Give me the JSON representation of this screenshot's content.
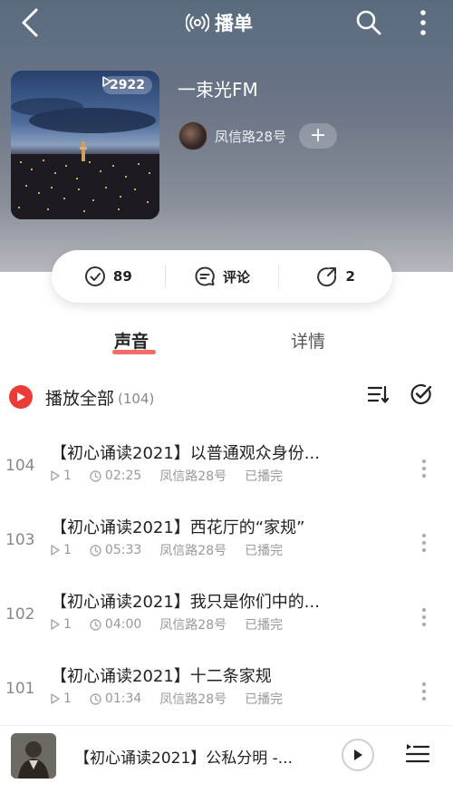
{
  "nav": {
    "title": "播单"
  },
  "playlist": {
    "title": "一束光FM",
    "play_count": "2922",
    "creator_name": "凤信路28号",
    "follow_label": "+"
  },
  "actions": {
    "subscribe_count": "89",
    "comment_label": "评论",
    "share_count": "2"
  },
  "tabs": [
    {
      "label": "声音",
      "active": true
    },
    {
      "label": "详情",
      "active": false
    }
  ],
  "play_all": {
    "label": "播放全部",
    "count": "(104)"
  },
  "tracks": [
    {
      "number": "104",
      "title": "【初心诵读2021】以普通观众身份...",
      "plays": "1",
      "duration": "02:25",
      "author": "凤信路28号",
      "status": "已播完"
    },
    {
      "number": "103",
      "title": "【初心诵读2021】西花厅的“家规”",
      "plays": "1",
      "duration": "05:33",
      "author": "凤信路28号",
      "status": "已播完"
    },
    {
      "number": "102",
      "title": "【初心诵读2021】我只是你们中的...",
      "plays": "1",
      "duration": "04:00",
      "author": "凤信路28号",
      "status": "已播完"
    },
    {
      "number": "101",
      "title": "【初心诵读2021】十二条家规",
      "plays": "1",
      "duration": "01:34",
      "author": "凤信路28号",
      "status": "已播完"
    }
  ],
  "mini_player": {
    "title": "【初心诵读2021】公私分明 -..."
  },
  "colors": {
    "accent": "#ec3a36",
    "tab_underline": "#f0524f"
  }
}
